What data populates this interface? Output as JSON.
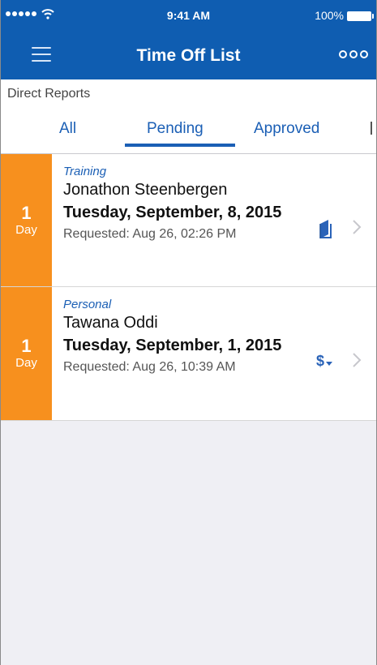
{
  "status_bar": {
    "time": "9:41 AM",
    "battery_percent": "100%"
  },
  "nav": {
    "title": "Time Off List",
    "menu_icon": "hamburger-menu-icon",
    "more_icon": "more-dots-icon"
  },
  "section": {
    "label": "Direct Reports"
  },
  "tabs": {
    "items": [
      {
        "label": "All"
      },
      {
        "label": "Pending"
      },
      {
        "label": "Approved"
      }
    ],
    "selected": "Pending"
  },
  "requests": [
    {
      "days": "1",
      "unit": "Day",
      "type": "Training",
      "name": "Jonathon Steenbergen",
      "date": "Tuesday, September, 8, 2015",
      "requested": "Requested: Aug 26, 02:26 PM",
      "icon": "book-icon"
    },
    {
      "days": "1",
      "unit": "Day",
      "type": "Personal",
      "name": "Tawana Oddi",
      "date": "Tuesday, September, 1, 2015",
      "requested": "Requested: Aug 26, 10:39 AM",
      "icon": "dollar-icon"
    }
  ],
  "colors": {
    "nav_blue": "#0f5db1",
    "accent_blue": "#1b5fb5",
    "badge_orange": "#f7901e",
    "background": "#efeff4"
  }
}
